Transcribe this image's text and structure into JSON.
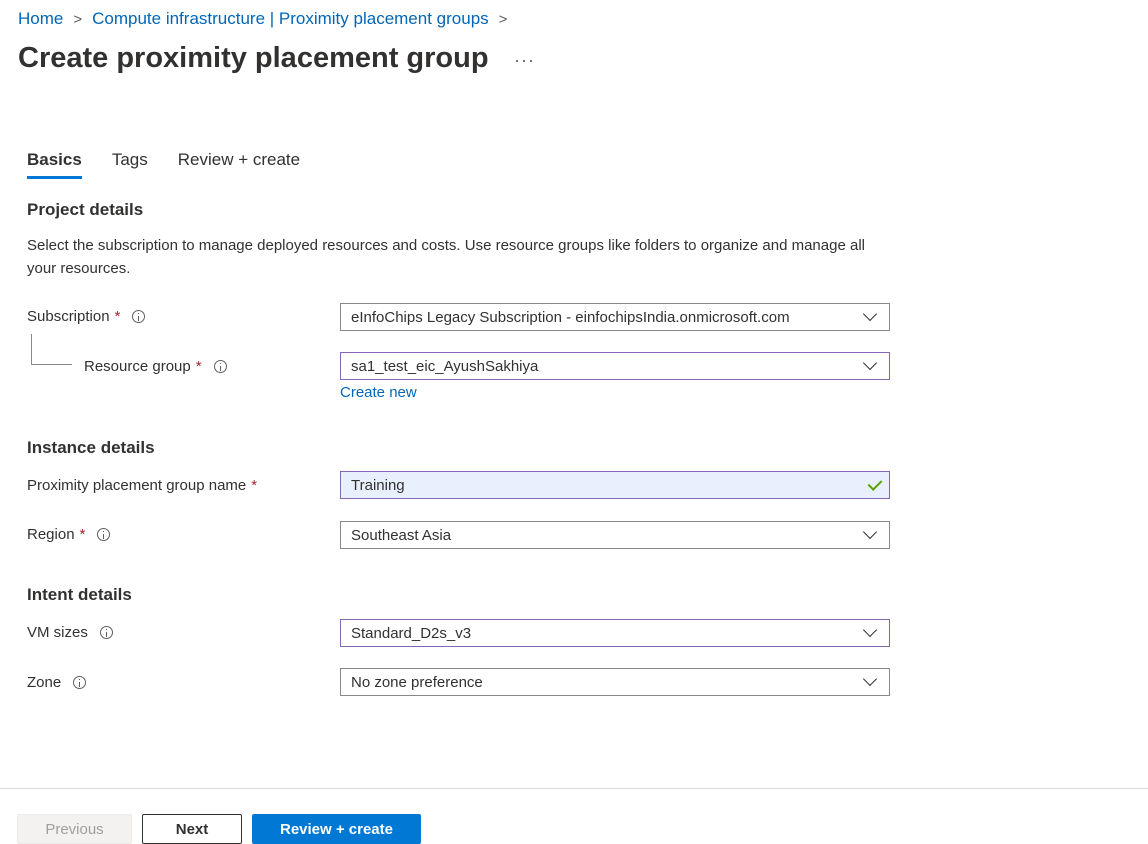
{
  "breadcrumb": {
    "home": "Home",
    "parent": "Compute infrastructure | Proximity placement groups",
    "separator": ">"
  },
  "page": {
    "title": "Create proximity placement group",
    "more": "···"
  },
  "tabs": [
    {
      "label": "Basics",
      "active": true
    },
    {
      "label": "Tags",
      "active": false
    },
    {
      "label": "Review + create",
      "active": false
    }
  ],
  "project": {
    "title": "Project details",
    "description": "Select the subscription to manage deployed resources and costs. Use resource groups like folders to organize and manage all your resources.",
    "subscription_label": "Subscription",
    "subscription_value": "eInfoChips Legacy Subscription - einfochipsIndia.onmicrosoft.com",
    "resource_group_label": "Resource group",
    "resource_group_value": "sa1_test_eic_AyushSakhiya",
    "create_new": "Create new"
  },
  "instance": {
    "title": "Instance details",
    "name_label": "Proximity placement group name",
    "name_value": "Training",
    "region_label": "Region",
    "region_value": "Southeast Asia"
  },
  "intent": {
    "title": "Intent details",
    "vm_sizes_label": "VM sizes",
    "vm_sizes_value": "Standard_D2s_v3",
    "zone_label": "Zone",
    "zone_value": "No zone preference"
  },
  "required_marker": "*",
  "footer": {
    "previous": "Previous",
    "next": "Next",
    "review_create": "Review + create"
  },
  "colors": {
    "accent": "#0078d4",
    "link": "#0067b8",
    "required": "#a4262c",
    "focus_border": "#8764b8",
    "valid_check": "#57a300"
  }
}
